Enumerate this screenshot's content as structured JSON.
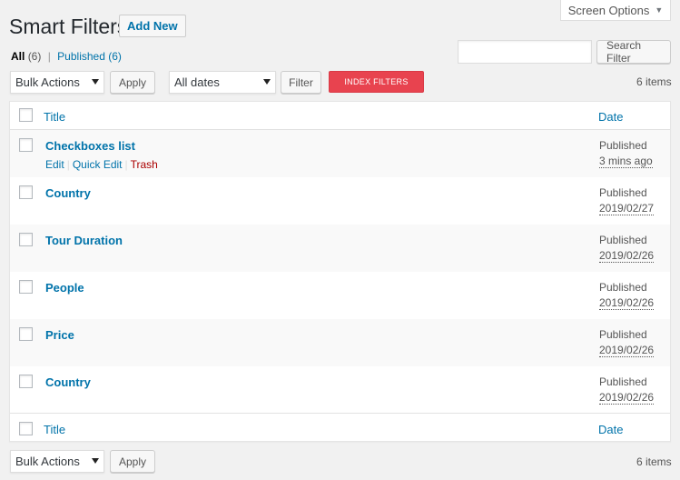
{
  "screen_options": {
    "label": "Screen Options",
    "caret": "▼"
  },
  "header": {
    "title": "Smart Filters",
    "add_new": "Add New"
  },
  "views": {
    "all_label": "All",
    "all_count": "(6)",
    "separator": "|",
    "published_label": "Published",
    "published_count": "(6)"
  },
  "search": {
    "placeholder": "",
    "value": "",
    "button": "Search Filter"
  },
  "toolbar_top": {
    "bulk_actions": "Bulk Actions",
    "apply": "Apply",
    "date_filter": "All dates",
    "filter": "Filter",
    "index_filters": "INDEX FILTERS",
    "items_count": "6 items"
  },
  "table": {
    "columns": {
      "title": "Title",
      "date": "Date"
    },
    "row_actions": {
      "edit": "Edit",
      "quick_edit": "Quick Edit",
      "trash": "Trash",
      "separator": "|"
    },
    "rows": [
      {
        "title": "Checkboxes list",
        "status": "Published",
        "date": "3 mins ago"
      },
      {
        "title": "Country",
        "status": "Published",
        "date": "2019/02/27"
      },
      {
        "title": "Tour Duration",
        "status": "Published",
        "date": "2019/02/26"
      },
      {
        "title": "People",
        "status": "Published",
        "date": "2019/02/26"
      },
      {
        "title": "Price",
        "status": "Published",
        "date": "2019/02/26"
      },
      {
        "title": "Country",
        "status": "Published",
        "date": "2019/02/26"
      }
    ]
  },
  "toolbar_bottom": {
    "bulk_actions": "Bulk Actions",
    "apply": "Apply",
    "items_count": "6 items"
  },
  "colors": {
    "link": "#0073aa",
    "index_button": "#e8434f",
    "trash": "#aa0000",
    "background": "#f1f1f1"
  }
}
